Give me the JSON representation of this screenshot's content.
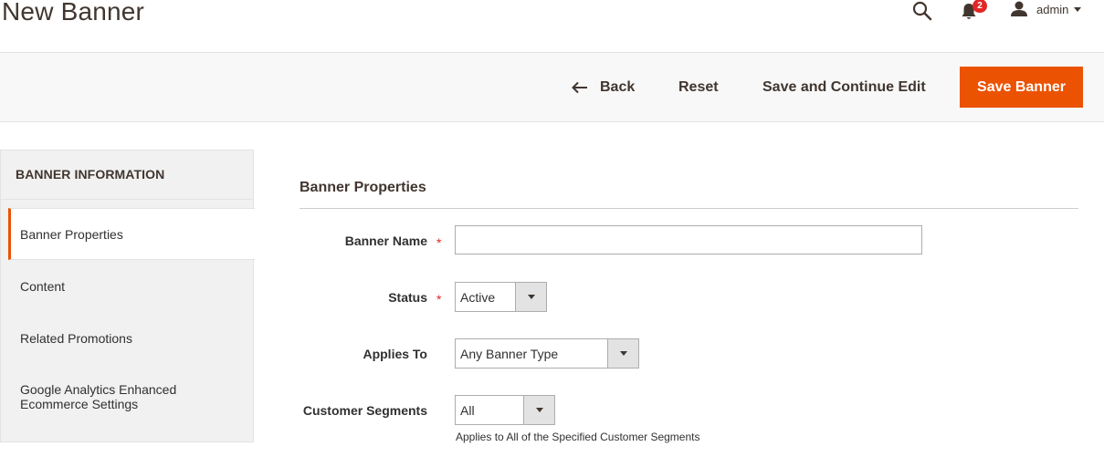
{
  "header": {
    "title": "New Banner",
    "notifications_count": "2",
    "user_name": "admin"
  },
  "actions": {
    "back_label": "Back",
    "reset_label": "Reset",
    "save_continue_label": "Save and Continue Edit",
    "save_label": "Save Banner"
  },
  "sidebar": {
    "title": "BANNER INFORMATION",
    "items": [
      {
        "label": "Banner Properties",
        "active": true
      },
      {
        "label": "Content",
        "active": false
      },
      {
        "label": "Related Promotions",
        "active": false
      },
      {
        "label": "Google Analytics Enhanced\nEcommerce Settings",
        "active": false
      }
    ]
  },
  "form": {
    "section_title": "Banner Properties",
    "banner_name": {
      "label": "Banner Name",
      "value": "",
      "required": "*"
    },
    "status": {
      "label": "Status",
      "value": "Active",
      "required": "*"
    },
    "applies_to": {
      "label": "Applies To",
      "value": "Any Banner Type"
    },
    "customer_segments": {
      "label": "Customer Segments",
      "value": "All",
      "note": "Applies to All of the Specified Customer Segments"
    }
  },
  "colors": {
    "accent": "#eb5202",
    "required": "#e22626",
    "badge": "#e22626"
  }
}
